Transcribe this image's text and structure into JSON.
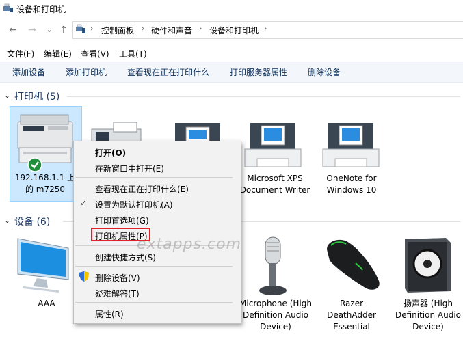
{
  "window": {
    "title": "设备和打印机"
  },
  "nav": {
    "back": "←",
    "forward": "→",
    "up": "↑",
    "recent": "⌄"
  },
  "breadcrumb": [
    "控制面板",
    "硬件和声音",
    "设备和打印机"
  ],
  "menubar": [
    "文件(F)",
    "编辑(E)",
    "查看(V)",
    "工具(T)"
  ],
  "commands": [
    "添加设备",
    "添加打印机",
    "查看现在正在打印什么",
    "打印服务器属性",
    "删除设备"
  ],
  "groups": {
    "printers": {
      "label": "打印机 (5)"
    },
    "devices": {
      "label": "设备 (6)"
    }
  },
  "printers": [
    {
      "label": "192.168.1.1 上的 m7250",
      "selected": true,
      "default": true
    },
    {
      "label": ""
    },
    {
      "label": ""
    },
    {
      "label": "Microsoft XPS Document Writer"
    },
    {
      "label": "OneNote for Windows 10"
    }
  ],
  "devices": [
    {
      "label": "AAA",
      "icon": "monitor-icon"
    },
    {
      "label": "Microphone (High Definition Audio Device)",
      "icon": "microphone-icon"
    },
    {
      "label": "Razer DeathAdder Essential",
      "icon": "mouse-icon"
    },
    {
      "label": "扬声器 (High Definition Audio Device)",
      "icon": "speaker-icon"
    }
  ],
  "context_menu": {
    "open": "打开(O)",
    "open_new_window": "在新窗口中打开(E)",
    "see_printing": "查看现在正在打印什么(E)",
    "set_default": "设置为默认打印机(A)",
    "print_prefs": "打印首选项(G)",
    "printer_props": "打印机属性(P)",
    "create_shortcut": "创建快捷方式(S)",
    "remove_device": "删除设备(V)",
    "troubleshoot": "疑难解答(T)",
    "properties": "属性(R)"
  },
  "watermark": "extapps.com",
  "colors": {
    "highlight": "#e0202a",
    "selection": "#cce8ff",
    "check": "#1e8f3a"
  }
}
